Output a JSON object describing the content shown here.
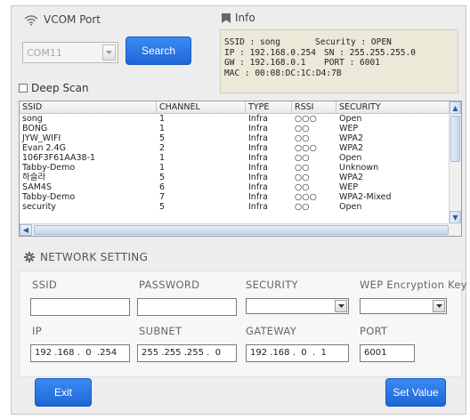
{
  "vcom": {
    "title": "VCOM Port",
    "port_value": "COM11",
    "search_label": "Search",
    "deep_scan_label": "Deep Scan"
  },
  "info": {
    "title": "Info",
    "ssid": "SSID : song",
    "security": "Security : OPEN",
    "ip": "IP : 192.168.0.254",
    "sn": "SN : 255.255.255.0",
    "gw": "GW : 192.168.0.1",
    "port": "PORT : 6001",
    "mac": "MAC : 00:08:DC:1C:D4:7B"
  },
  "list": {
    "headers": [
      "SSID",
      "CHANNEL",
      "TYPE",
      "RSSI",
      "SECURITY"
    ],
    "rows": [
      [
        "song",
        "1",
        "Infra",
        "○○○",
        "Open"
      ],
      [
        "BONG",
        "1",
        "Infra",
        "○○",
        "WEP"
      ],
      [
        "JYW_WIFI",
        "5",
        "Infra",
        "○○",
        "WPA2"
      ],
      [
        "Evan 2.4G",
        "2",
        "Infra",
        "○○○",
        "WPA2"
      ],
      [
        "106F3F61AA38-1",
        "1",
        "Infra",
        "○○",
        "Open"
      ],
      [
        "Tabby-Demo",
        "1",
        "Infra",
        "○○",
        "Unknown"
      ],
      [
        "하슬라",
        "5",
        "Infra",
        "○○",
        "WPA2"
      ],
      [
        "SAM4S",
        "6",
        "Infra",
        "○○",
        "WEP"
      ],
      [
        "Tabby-Demo",
        "7",
        "Infra",
        "○○○",
        "WPA2-Mixed"
      ],
      [
        "security",
        "5",
        "Infra",
        "○○",
        "Open"
      ]
    ]
  },
  "network": {
    "title": "NETWORK SETTING",
    "labels": {
      "ssid": "SSID",
      "password": "PASSWORD",
      "security": "SECURITY",
      "wep_key": "WEP Encryption Key",
      "ip": "IP",
      "subnet": "SUBNET",
      "gateway": "GATEWAY",
      "port": "PORT"
    },
    "values": {
      "ssid": "",
      "password": "",
      "ip": "192 .168 .  0  .254",
      "subnet": "255 .255 .255 .  0",
      "gateway": "192 .168 .  0  .  1",
      "port": "6001"
    }
  },
  "buttons": {
    "exit": "Exit",
    "set_value": "Set Value"
  },
  "colors": {
    "accent_button": "#2a78e6",
    "info_background": "#ece9d8",
    "window_background": "#ededed"
  }
}
